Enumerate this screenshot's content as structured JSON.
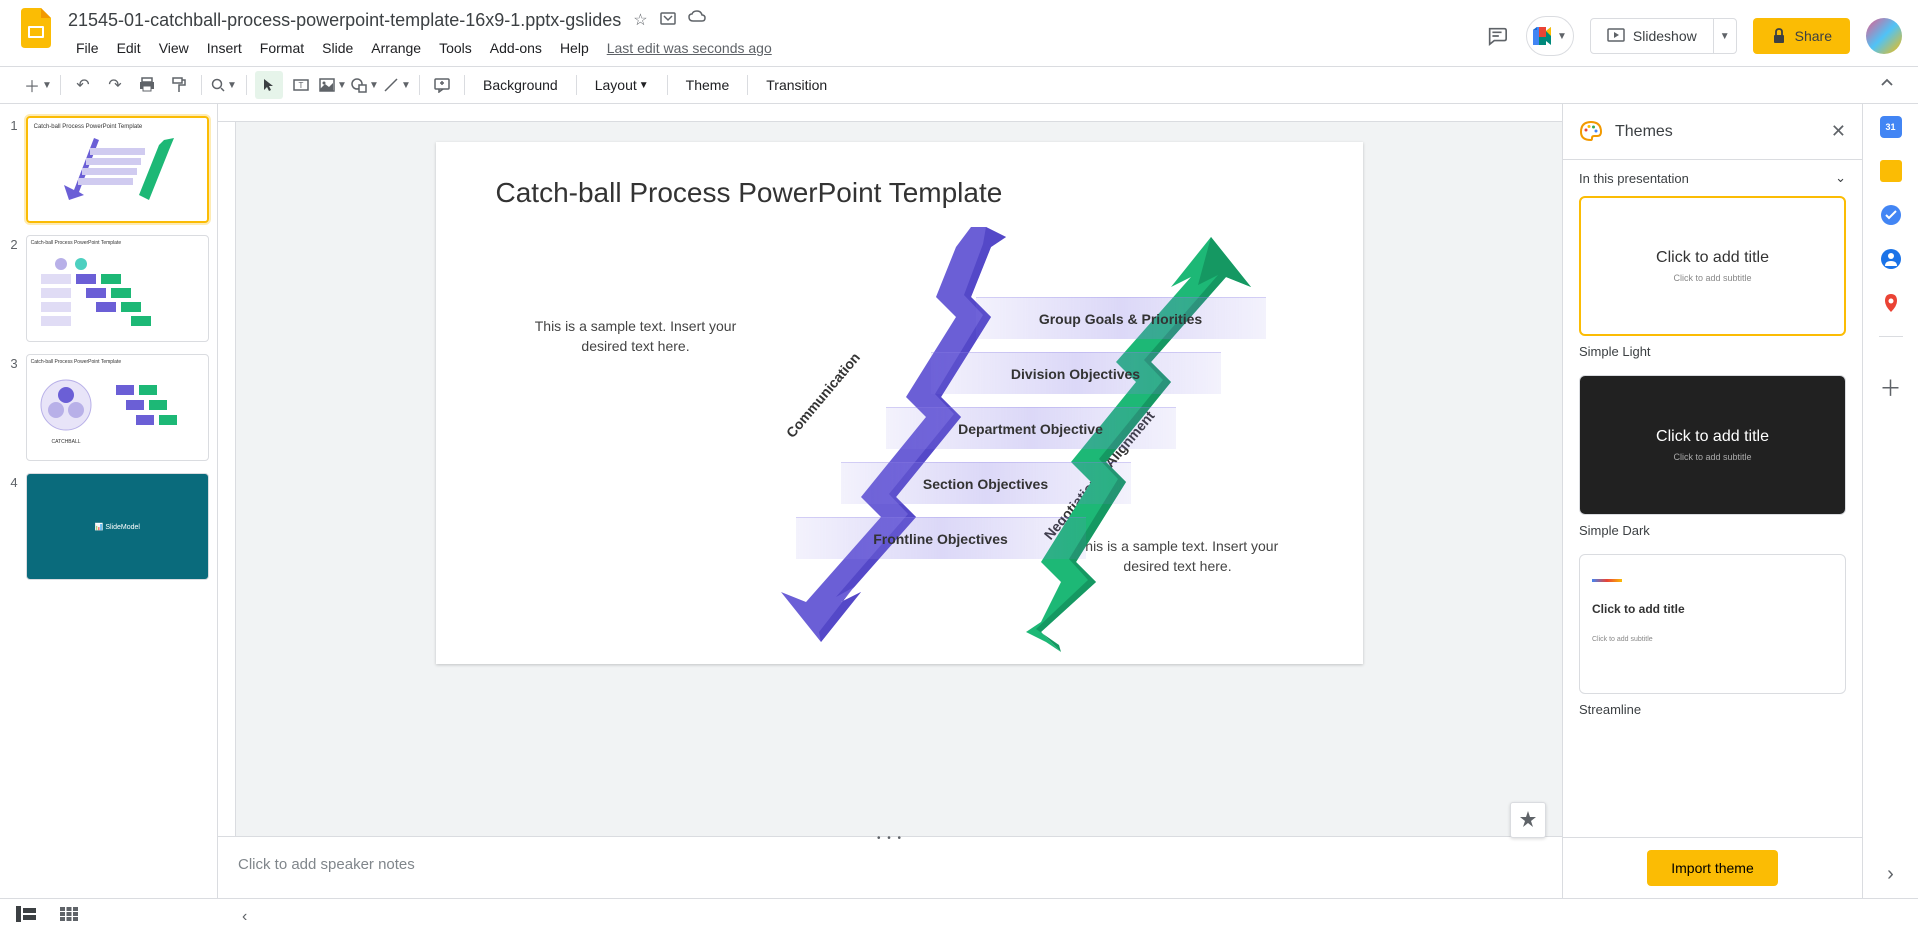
{
  "doc": {
    "title": "21545-01-catchball-process-powerpoint-template-16x9-1.pptx-gslides",
    "last_edit": "Last edit was seconds ago"
  },
  "menus": [
    "File",
    "Edit",
    "View",
    "Insert",
    "Format",
    "Slide",
    "Arrange",
    "Tools",
    "Add-ons",
    "Help"
  ],
  "header": {
    "slideshow": "Slideshow",
    "share": "Share"
  },
  "toolbar": {
    "background": "Background",
    "layout": "Layout",
    "theme": "Theme",
    "transition": "Transition"
  },
  "thumbs": {
    "n1": "1",
    "n2": "2",
    "n3": "3",
    "n4": "4"
  },
  "slide": {
    "title": "Catch-ball Process PowerPoint Template",
    "sample": "This is a sample text. Insert your desired text here.",
    "comm": "Communication",
    "neg": "Negotiation & Alignment",
    "rungs": [
      "Group Goals & Priorities",
      "Division Objectives",
      "Department Objective",
      "Section Objectives",
      "Frontline Objectives"
    ]
  },
  "notes": {
    "placeholder": "Click to add speaker notes"
  },
  "themes": {
    "title": "Themes",
    "section": "In this presentation",
    "card_title": "Click to add title",
    "card_sub": "Click to add subtitle",
    "names": [
      "Simple Light",
      "Simple Dark",
      "Streamline"
    ],
    "import": "Import theme"
  }
}
